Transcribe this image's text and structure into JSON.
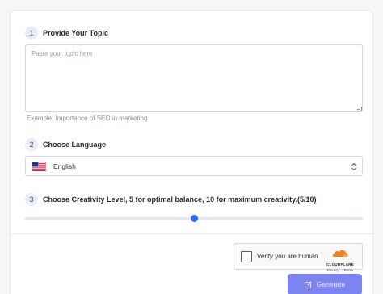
{
  "steps": [
    {
      "number": "1",
      "label": "Provide Your Topic"
    },
    {
      "number": "2",
      "label": "Choose Language"
    },
    {
      "number": "3",
      "label": "Choose Creativity Level, 5 for optimal balance, 10 for maximum creativity.(5/10)"
    }
  ],
  "topic": {
    "value": "",
    "placeholder": "Paste your topic here",
    "example": "Example:  Importance of SEO in marketing"
  },
  "language": {
    "selected": "English",
    "flag_icon": "us-flag-icon"
  },
  "creativity": {
    "value": 5,
    "min": 0,
    "max": 10
  },
  "captcha": {
    "label": "Verify you are human",
    "brand": "CLOUDFLARE",
    "privacy": "Privacy",
    "terms": "Terms"
  },
  "generate": {
    "label": "Generate",
    "icon": "edit-icon"
  },
  "colors": {
    "accent": "#2d6df6",
    "button": "#7b84f0",
    "cloudflare": "#f38020"
  }
}
